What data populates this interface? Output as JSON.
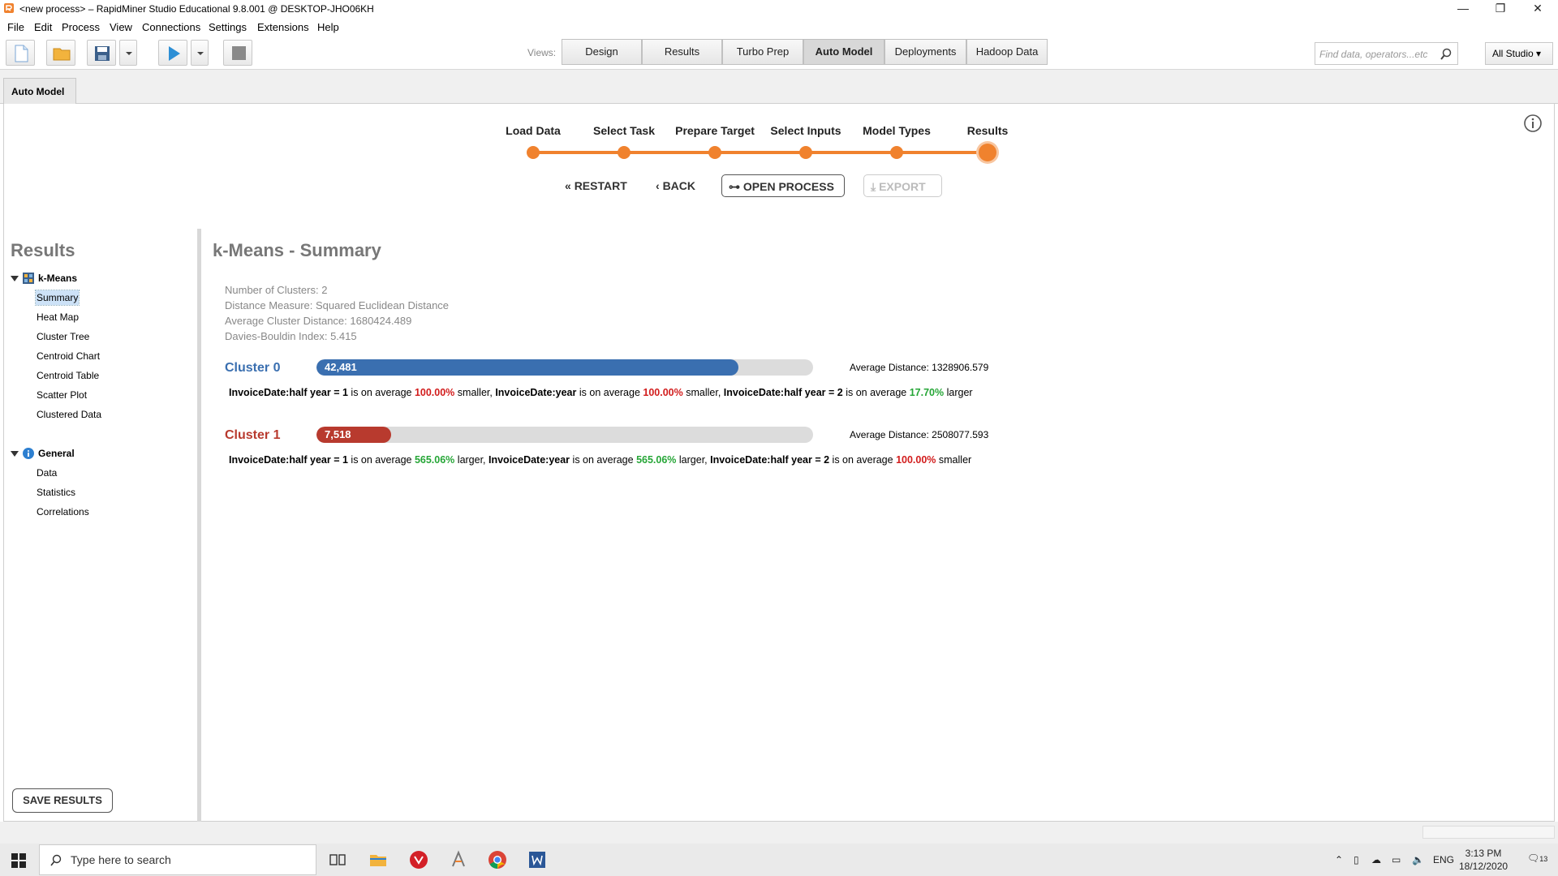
{
  "window": {
    "title": "<new process> – RapidMiner Studio Educational 9.8.001 @ DESKTOP-JHO06KH",
    "minimize": "—",
    "maximize": "❐",
    "close": "✕"
  },
  "menu": [
    "File",
    "Edit",
    "Process",
    "View",
    "Connections",
    "Settings",
    "Extensions",
    "Help"
  ],
  "toolbar": {
    "views_label": "Views:",
    "views": [
      "Design",
      "Results",
      "Turbo Prep",
      "Auto Model",
      "Deployments",
      "Hadoop Data"
    ],
    "active_view": "Auto Model",
    "search_placeholder": "Find data, operators...etc",
    "studio_dropdown": "All Studio ▾"
  },
  "doc_tab": "Auto Model",
  "wizard": {
    "steps": [
      "Load Data",
      "Select Task",
      "Prepare Target",
      "Select Inputs",
      "Model Types",
      "Results"
    ],
    "current_step": 5,
    "accent_color": "#f0822e",
    "restart": "RESTART",
    "back": "BACK",
    "open_process": "OPEN PROCESS",
    "export": "EXPORT"
  },
  "sidebar": {
    "title": "Results",
    "groups": [
      {
        "label": "k-Means",
        "icon": "grid-icon",
        "items": [
          "Summary",
          "Heat Map",
          "Cluster Tree",
          "Centroid Chart",
          "Centroid Table",
          "Scatter Plot",
          "Clustered Data"
        ]
      },
      {
        "label": "General",
        "icon": "info-icon",
        "items": [
          "Data",
          "Statistics",
          "Correlations"
        ]
      }
    ],
    "selected": "Summary",
    "save_button": "SAVE RESULTS"
  },
  "summary": {
    "title": "k-Means - Summary",
    "stats": [
      "Number of Clusters: 2",
      "Distance Measure: Squared Euclidean Distance",
      "Average Cluster Distance: 1680424.489",
      "Davies-Bouldin Index: 5.415"
    ],
    "clusters": [
      {
        "name": "Cluster 0",
        "count_label": "42,481",
        "fraction": 0.85,
        "color": "#3a6fb0",
        "avg_distance": "Average Distance: 1328906.579",
        "desc": [
          {
            "t": "InvoiceDate:half year = 1",
            "s": "b"
          },
          {
            "t": " is on average ",
            "s": "n"
          },
          {
            "t": "100.00%",
            "s": "neg"
          },
          {
            "t": " smaller, ",
            "s": "n"
          },
          {
            "t": "InvoiceDate:year",
            "s": "b"
          },
          {
            "t": " is on average ",
            "s": "n"
          },
          {
            "t": "100.00%",
            "s": "neg"
          },
          {
            "t": " smaller, ",
            "s": "n"
          },
          {
            "t": "InvoiceDate:half year = 2",
            "s": "b"
          },
          {
            "t": " is on average ",
            "s": "n"
          },
          {
            "t": "17.70%",
            "s": "pos"
          },
          {
            "t": " larger",
            "s": "n"
          }
        ]
      },
      {
        "name": "Cluster 1",
        "count_label": "7,518",
        "fraction": 0.15,
        "color": "#b83a2e",
        "avg_distance": "Average Distance: 2508077.593",
        "desc": [
          {
            "t": "InvoiceDate:half year = 1",
            "s": "b"
          },
          {
            "t": " is on average ",
            "s": "n"
          },
          {
            "t": "565.06%",
            "s": "pos"
          },
          {
            "t": " larger, ",
            "s": "n"
          },
          {
            "t": "InvoiceDate:year",
            "s": "b"
          },
          {
            "t": " is on average ",
            "s": "n"
          },
          {
            "t": "565.06%",
            "s": "pos"
          },
          {
            "t": " larger, ",
            "s": "n"
          },
          {
            "t": "InvoiceDate:half year = 2",
            "s": "b"
          },
          {
            "t": " is on average ",
            "s": "n"
          },
          {
            "t": "100.00%",
            "s": "neg"
          },
          {
            "t": " smaller",
            "s": "n"
          }
        ]
      }
    ]
  },
  "taskbar": {
    "search_placeholder": "Type here to search",
    "apps": [
      "task-view-icon",
      "file-explorer-icon",
      "evernote-icon",
      "rapidminer-icon",
      "chrome-icon",
      "word-icon"
    ],
    "lang": "ENG",
    "time": "3:13 PM",
    "date": "18/12/2020",
    "notif_count": "13"
  }
}
